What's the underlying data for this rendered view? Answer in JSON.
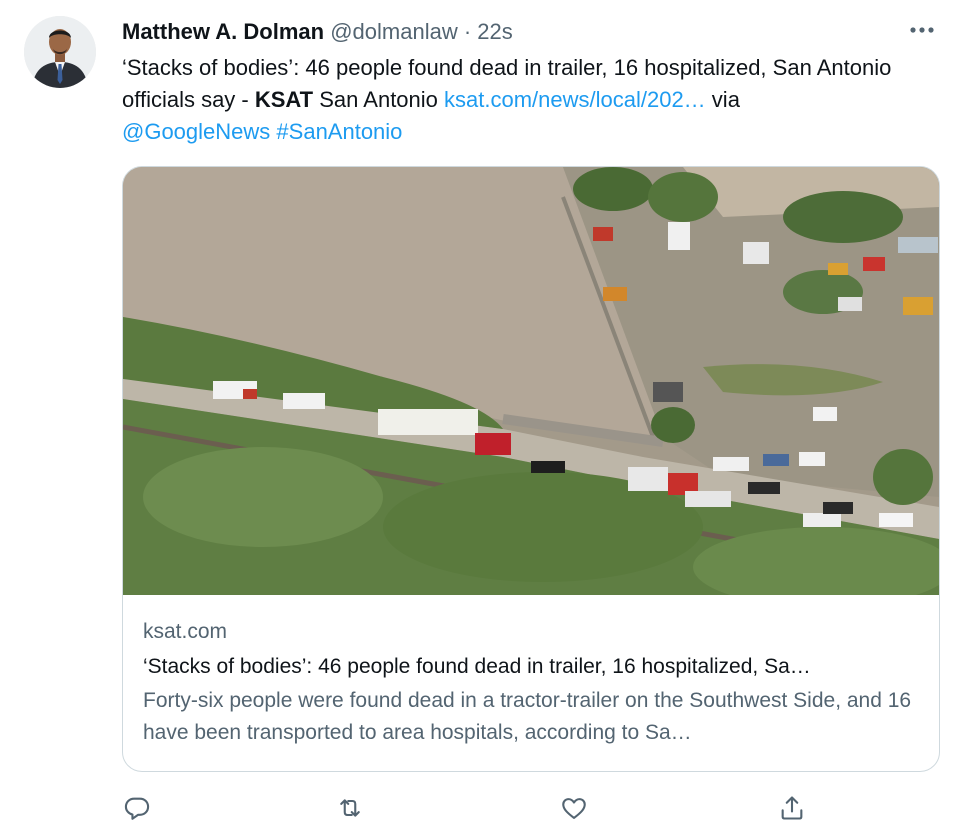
{
  "author": {
    "name": "Matthew A. Dolman",
    "handle": "@dolmanlaw",
    "separator": "·",
    "time": "22s"
  },
  "more_icon": "more-horizontal-icon",
  "tweet": {
    "text_1": "‘Stacks of bodies’: 46 people found dead in trailer, 16 hospitalized, San Antonio officials say - ",
    "text_bold": "KSAT",
    "text_2": " San Antonio ",
    "link": "ksat.com/news/local/202…",
    "text_3": " via",
    "mention": "@GoogleNews",
    "hashtag": "#SanAntonio"
  },
  "card": {
    "domain": "ksat.com",
    "title": "‘Stacks of bodies’: 46 people found dead in trailer, 16 hospitalized, Sa…",
    "description": "Forty-six people were found dead in a tractor-trailer on the Southwest Side, and 16 have been transported to area hospitals, according to Sa…"
  },
  "actions": {
    "reply_icon": "reply-icon",
    "retweet_icon": "retweet-icon",
    "like_icon": "like-icon",
    "share_icon": "share-icon"
  },
  "colors": {
    "link": "#1d9bf0",
    "muted": "#536471",
    "text": "#0f1419",
    "border": "#cfd9de"
  }
}
